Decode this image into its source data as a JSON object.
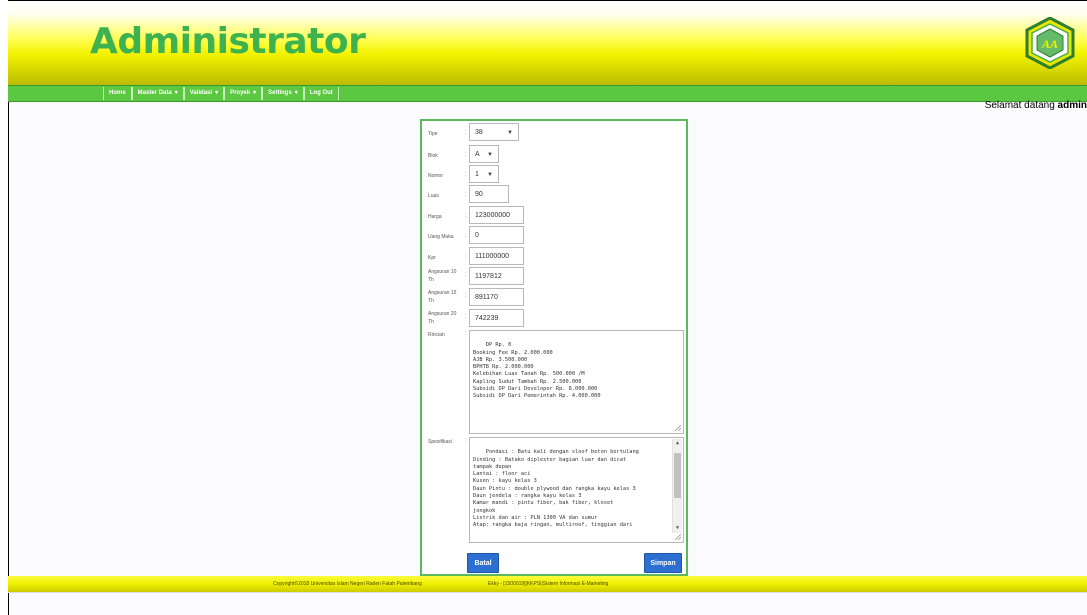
{
  "header": {
    "title": "Administrator",
    "logo_text": "AA",
    "colors": {
      "title": "#3db24f",
      "header_yellow": "#f3f300",
      "nav_green": "#5cc842"
    }
  },
  "nav": {
    "items": [
      {
        "label": "Home",
        "has_caret": false
      },
      {
        "label": "Master Data",
        "has_caret": true
      },
      {
        "label": "Validasi",
        "has_caret": true
      },
      {
        "label": "Proyek",
        "has_caret": true
      },
      {
        "label": "Settings",
        "has_caret": true
      },
      {
        "label": "Log Out",
        "has_caret": false
      }
    ],
    "caret_glyph": "▾"
  },
  "welcome": {
    "prefix": "Selamat datang",
    "user": "admin"
  },
  "form": {
    "colon": ":",
    "select_arrow": "▼",
    "tipe": {
      "label": "Tipe",
      "value": "38"
    },
    "blok": {
      "label": "Blok",
      "value": "A"
    },
    "nomor": {
      "label": "Nomor",
      "value": "1"
    },
    "luas": {
      "label": "Luas",
      "value": "90"
    },
    "harga": {
      "label": "Harga",
      "value": "123000000"
    },
    "uang_muka": {
      "label": "Uang Muka",
      "value": "0"
    },
    "kpr": {
      "label": "Kpr",
      "value": "111000000"
    },
    "angsuran_10": {
      "label": "Angsuran 10",
      "label2": "Th",
      "value": "1197812"
    },
    "angsuran_15": {
      "label": "Angsuran 15",
      "label2": "Th",
      "value": "891170"
    },
    "angsuran_20": {
      "label": "Angsuran 20",
      "label2": "Th",
      "value": "742239"
    },
    "rincian": {
      "label": "Rincian",
      "value": "DP Rp. 0\nBooking Fee Rp. 2.000.000\nAJB Rp. 3.500.000\nBPHTB Rp. 2.000.000\nKelebihan Luas Tanah Rp. 500.000 /M\nKapling Sudut Tambah Rp. 2.500.000\nSubsidi DP Dari Developer Rp. 8.000.000\nSubsidi DP Dari Pemerintah Rp. 4.000.000"
    },
    "spesifikasi": {
      "label": "Spesifikasi",
      "value": "Pondasi : Batu kali dengan sloof beton bertulang\nDinding : Batako diplester bagian luar dan dicat\ntampak depan\nLantai : floor aci\nKusen : kayu kelas 3\nDaun Pintu : double plywood dan rangka kayu kelas 3\nDaun jendela : rangka kayu kelas 3\nKamar mandi : pintu fiber, bak fiber, kloset\njongkok\nListrik dan air : PLN 1300 VA dan sumur\nAtap: rangka baja ringan, multiroof, tinggian dari"
    },
    "scroll_up": "▲",
    "scroll_down": "▼",
    "batal_label": "Batal",
    "simpan_label": "Simpan",
    "button_color": "#2c6fd1"
  },
  "footer": {
    "copyright": "Copyright©2018 Universitas Islam Negeri Raden Fatah Palembang",
    "credit": "Ekky - [1500019]|KKPSI|Sistem Informasi E-Marketing"
  }
}
